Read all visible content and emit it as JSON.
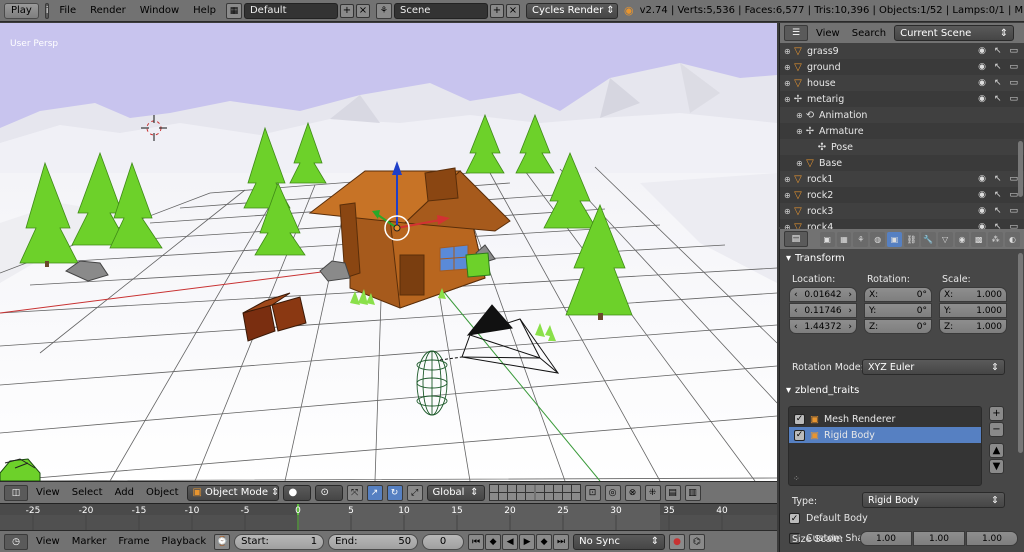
{
  "topbar": {
    "play": "Play",
    "menus": [
      "File",
      "Render",
      "Window",
      "Help"
    ],
    "layout": "Default",
    "scene": "Scene",
    "engine": "Cycles Render",
    "stats": "v2.74 | Verts:5,536 | Faces:6,577 | Tris:10,396 | Objects:1/52 | Lamps:0/1 | M"
  },
  "viewport": {
    "label": "User Persp"
  },
  "viewport_header": {
    "menus": [
      "View",
      "Select",
      "Add",
      "Object"
    ],
    "mode": "Object Mode",
    "orientation": "Global"
  },
  "timeline": {
    "ticks": [
      "-25",
      "-20",
      "-15",
      "-10",
      "-5",
      "0",
      "5",
      "10",
      "15",
      "20",
      "25",
      "30",
      "35",
      "40"
    ],
    "current_frame": 0,
    "menus": [
      "View",
      "Marker",
      "Frame",
      "Playback"
    ],
    "start_label": "Start:",
    "start_value": "1",
    "end_label": "End:",
    "end_value": "50",
    "sync": "No Sync"
  },
  "outliner": {
    "menus": [
      "View",
      "Search"
    ],
    "scene_select": "Current Scene",
    "rows": [
      {
        "name": "grass9",
        "indent": 0,
        "icon": "mesh-icon"
      },
      {
        "name": "ground",
        "indent": 0,
        "icon": "mesh-icon"
      },
      {
        "name": "house",
        "indent": 0,
        "icon": "mesh-icon"
      },
      {
        "name": "metarig",
        "indent": 0,
        "icon": "armature-icon"
      },
      {
        "name": "Animation",
        "indent": 1,
        "icon": "animation-icon"
      },
      {
        "name": "Armature",
        "indent": 1,
        "icon": "armature-icon"
      },
      {
        "name": "Pose",
        "indent": 2,
        "icon": "pose-icon"
      },
      {
        "name": "Base",
        "indent": 1,
        "icon": "mesh-icon"
      },
      {
        "name": "rock1",
        "indent": 0,
        "icon": "mesh-icon"
      },
      {
        "name": "rock2",
        "indent": 0,
        "icon": "mesh-icon"
      },
      {
        "name": "rock3",
        "indent": 0,
        "icon": "mesh-icon"
      },
      {
        "name": "rock4",
        "indent": 0,
        "icon": "mesh-icon"
      }
    ]
  },
  "properties": {
    "transform_title": "Transform",
    "location_label": "Location:",
    "rotation_label": "Rotation:",
    "scale_label": "Scale:",
    "location": [
      "0.01642",
      "0.11746",
      "1.44372"
    ],
    "rotation_axes": [
      "X:",
      "Y:",
      "Z:"
    ],
    "rotation": [
      "0°",
      "0°",
      "0°"
    ],
    "scale_axes": [
      "X:",
      "Y:",
      "Z:"
    ],
    "scale": [
      "1.000",
      "1.000",
      "1.000"
    ],
    "rotation_mode_label": "Rotation Mode:",
    "rotation_mode": "XYZ Euler",
    "traits_title": "zblend_traits",
    "traits": [
      {
        "name": "Mesh Renderer",
        "checked": true,
        "active": false
      },
      {
        "name": "Rigid Body",
        "checked": true,
        "active": true
      }
    ],
    "type_label": "Type:",
    "type_value": "Rigid Body",
    "default_body_label": "Default Body",
    "custom_shape_label": "Custom Shape",
    "size_scale_label": "Size Scale:",
    "size_scale": [
      "1.00",
      "1.00",
      "1.00"
    ]
  },
  "colors": {
    "accent": "#5680c2",
    "header": "#727272",
    "panel": "#474747",
    "sky": "#c8c4ee",
    "tree": "#6dd12a",
    "house": "#a65a1c"
  }
}
